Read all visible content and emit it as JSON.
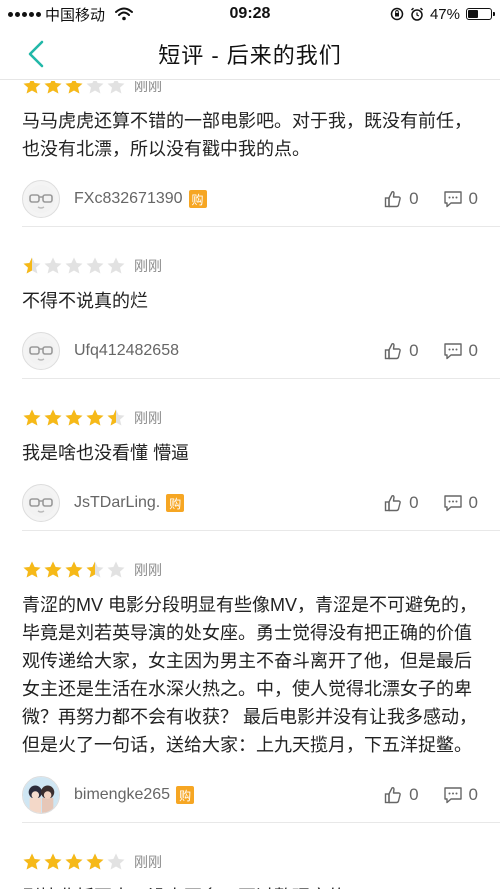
{
  "status_bar": {
    "carrier": "中国移动",
    "time": "09:28",
    "battery": "47%"
  },
  "nav": {
    "title": "短评 - 后来的我们"
  },
  "reviews": [
    {
      "stars": 3,
      "time": "刚刚",
      "text": "马马虎虎还算不错的一部电影吧。对于我，既没有前任，也没有北漂，所以没有戳中我的点。",
      "user": "FXc832671390",
      "buy_badge": "购",
      "likes": "0",
      "comments": "0",
      "avatar": "glasses-avatar"
    },
    {
      "stars": 0.5,
      "time": "刚刚",
      "text": "不得不说真的烂",
      "user": "Ufq412482658",
      "buy_badge": "",
      "likes": "0",
      "comments": "0",
      "avatar": "glasses-avatar"
    },
    {
      "stars": 4.5,
      "time": "刚刚",
      "text": "我是啥也没看懂 懵逼",
      "user": "JsTDarLing.",
      "buy_badge": "购",
      "likes": "0",
      "comments": "0",
      "avatar": "glasses-avatar"
    },
    {
      "stars": 3.5,
      "time": "刚刚",
      "text": "青涩的MV 电影分段明显有些像MV，青涩是不可避免的，毕竟是刘若英导演的处女座。勇士觉得没有把正确的价值观传递给大家，女主因为男主不奋斗离开了他，但是最后女主还是生活在水深火热之。中，使人觉得北漂女子的卑微？再努力都不会有收获？ 最后电影并没有让我多感动，但是火了一句话，送给大家：上九天揽月，下五洋捉鳖。",
      "user": "bimengke265",
      "buy_badge": "购",
      "likes": "0",
      "comments": "0",
      "avatar": "photo-avatar"
    },
    {
      "stars": 4,
      "time": "刚刚",
      "text": "剧情曲折不大，没占不多，不过整理实的",
      "user": "",
      "buy_badge": "",
      "likes": "",
      "comments": "",
      "avatar": ""
    }
  ],
  "colors": {
    "star_filled": "#f6b918",
    "star_empty": "#e2e2e2",
    "accent": "#22b8a8",
    "badge": "#f6a623"
  }
}
